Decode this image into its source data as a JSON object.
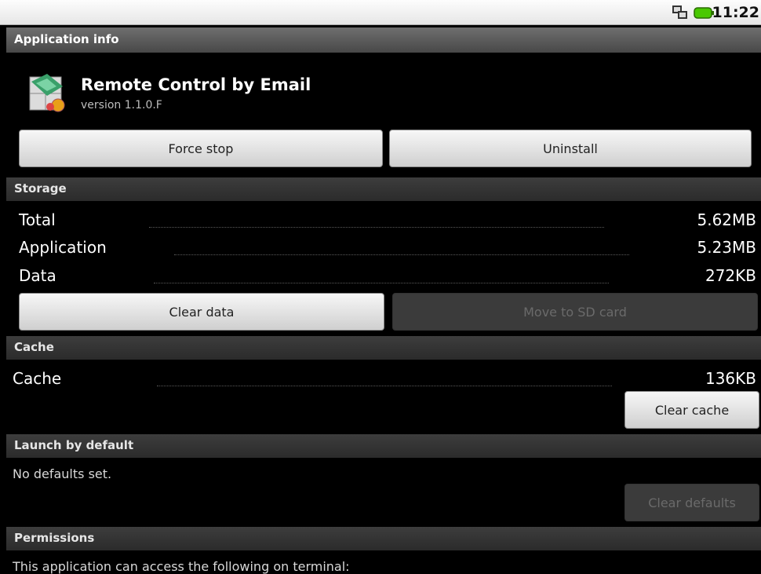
{
  "status_bar": {
    "time": "11:22"
  },
  "header": {
    "title": "Application info"
  },
  "app": {
    "name": "Remote Control by Email",
    "version": "version 1.1.0.F"
  },
  "actions": {
    "force_stop": "Force stop",
    "uninstall": "Uninstall"
  },
  "storage": {
    "title": "Storage",
    "rows": [
      {
        "label": "Total",
        "value": "5.62MB"
      },
      {
        "label": "Application",
        "value": "5.23MB"
      },
      {
        "label": "Data",
        "value": "272KB"
      }
    ],
    "clear_data": "Clear data",
    "move_to_sd": "Move to SD card"
  },
  "cache": {
    "title": "Cache",
    "label": "Cache",
    "value": "136KB",
    "clear_cache": "Clear cache"
  },
  "launch": {
    "title": "Launch by default",
    "text": "No defaults set.",
    "clear_defaults": "Clear defaults"
  },
  "permissions": {
    "title": "Permissions",
    "text": "This application can access the following on terminal:"
  },
  "icons": {
    "network": "network-icon",
    "battery": "battery-icon",
    "app": "app-icon"
  }
}
